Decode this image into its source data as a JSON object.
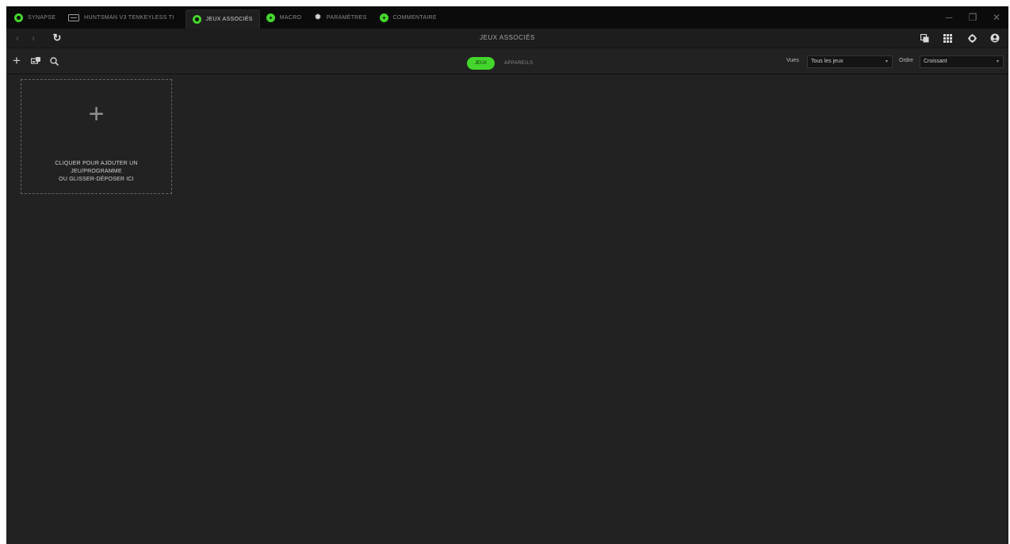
{
  "tabs": [
    {
      "label": "SYNAPSE",
      "icon": "razer-logo-icon",
      "active": false
    },
    {
      "label": "HUNTSMAN V3 TENKEYLESS TI",
      "icon": "keyboard-icon",
      "active": false
    },
    {
      "label": "JEUX ASSOCIÉS",
      "icon": "gamepad-icon",
      "active": true
    },
    {
      "label": "MACRO",
      "icon": "macro-icon",
      "active": false
    },
    {
      "label": "PARAMÈTRES",
      "icon": "gear-icon",
      "active": false
    },
    {
      "label": "COMMENTAIRE",
      "icon": "feedback-icon",
      "active": false
    }
  ],
  "window_controls": {
    "minimize": "─",
    "maximize": "❐",
    "close": "✕"
  },
  "nav": {
    "back": "‹",
    "forward": "›",
    "refresh": "↻",
    "title": "JEUX ASSOCIÉS"
  },
  "toolbar": {
    "add": "+",
    "add_device": "⎙",
    "search": "⌕",
    "segment_jeux": "JEUX",
    "segment_appareils": "APPAREILS",
    "view_label": "Vues",
    "view_value": "Tous les jeux",
    "order_label": "Ordre",
    "order_value": "Croissant",
    "caret": "▾"
  },
  "add_card": {
    "plus": "+",
    "line1": "CLIQUER POUR AJOUTER UN",
    "line2": "JEU/PROGRAMME",
    "line3": "OU GLISSER-DÉPOSER ICI"
  },
  "colors": {
    "accent": "#44d62c",
    "background": "#222222",
    "titlebar": "#0b0b0b"
  }
}
